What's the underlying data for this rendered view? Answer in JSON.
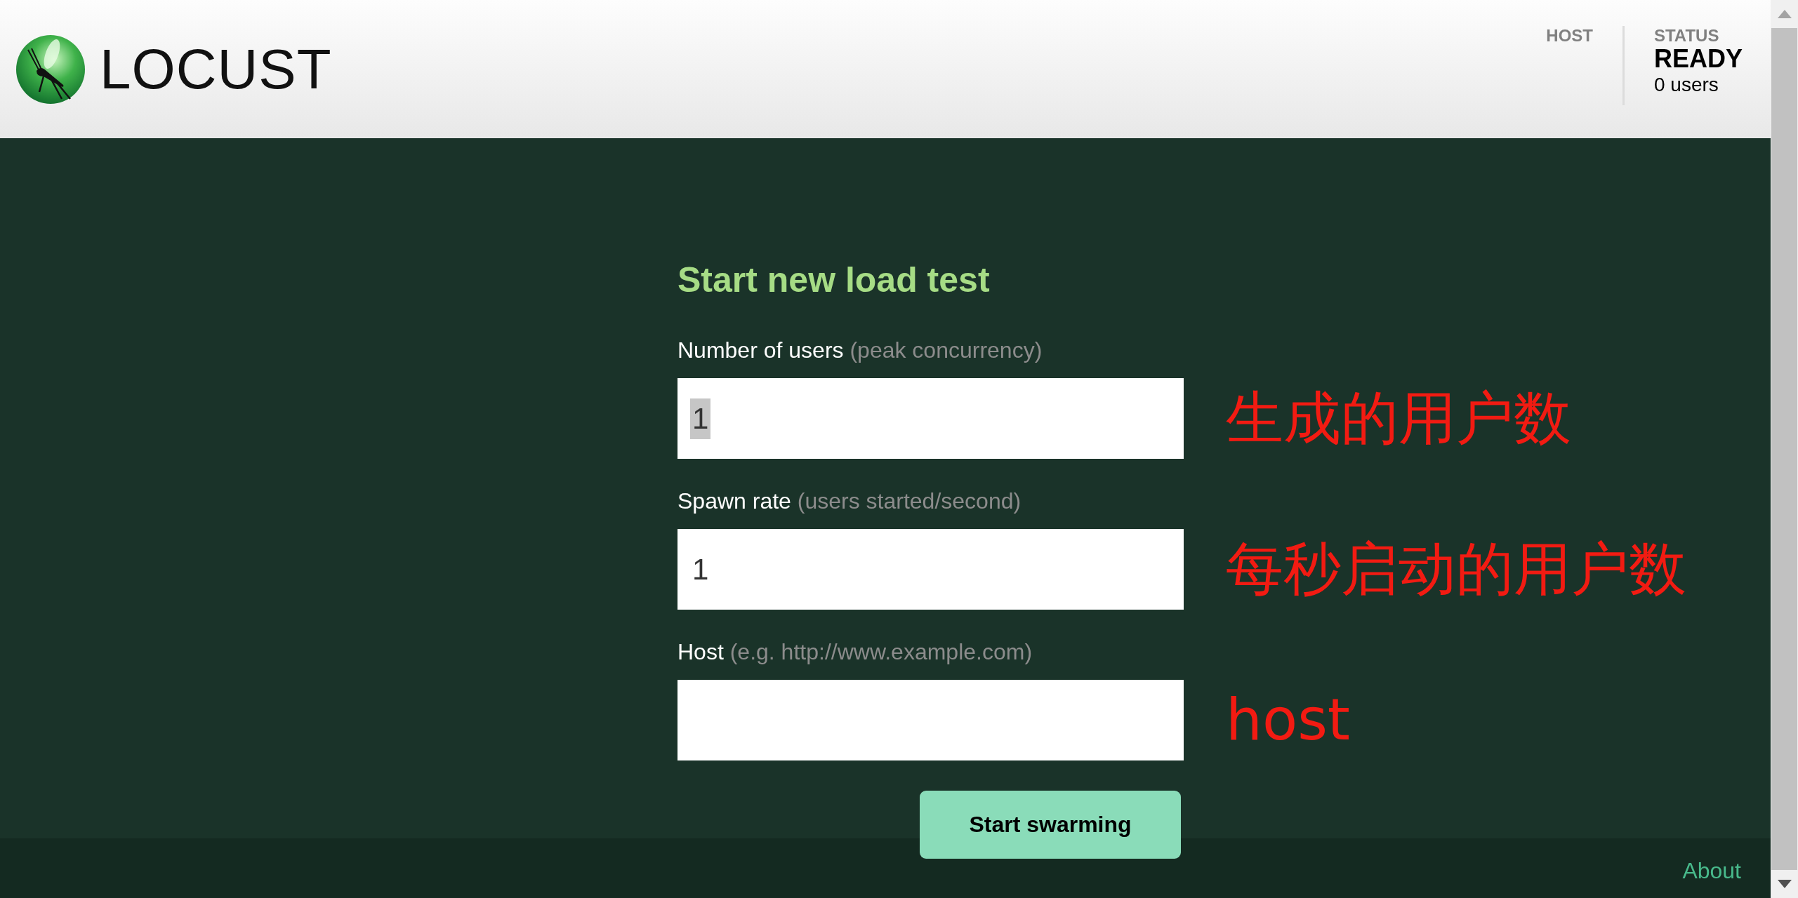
{
  "header": {
    "logo": "LOCUST",
    "host": {
      "label": "HOST"
    },
    "status": {
      "label": "STATUS",
      "value": "READY",
      "users": "0 users"
    }
  },
  "form": {
    "title": "Start new load test",
    "fields": [
      {
        "label": "Number of users",
        "hint": "(peak concurrency)",
        "value": "1",
        "highlighted": true,
        "annotation": "生成的用户数"
      },
      {
        "label": "Spawn rate",
        "hint": "(users started/second)",
        "value": "1",
        "highlighted": false,
        "annotation": "每秒启动的用户数"
      },
      {
        "label": "Host",
        "hint": "(e.g. http://www.example.com)",
        "annotation": "host"
      }
    ],
    "submit": "Start swarming"
  },
  "footer": {
    "link": "About"
  }
}
